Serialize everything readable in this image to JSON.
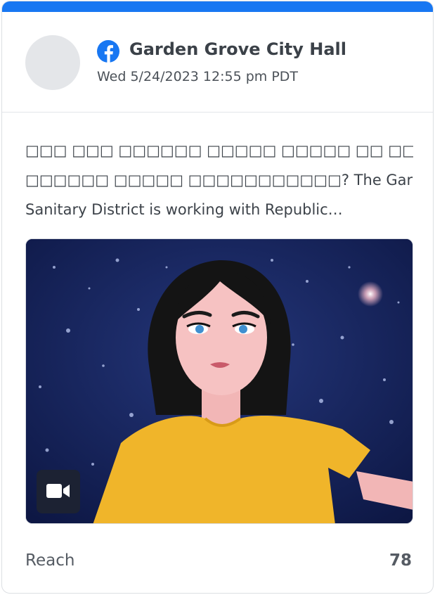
{
  "post": {
    "page_name": "Garden Grove City Hall",
    "timestamp": "Wed 5/24/2023 12:55 pm PDT",
    "text_line1": "□□□ □□□ □□□□□□ □□□□□ □□□□□ □□ □□□□□ □□□□□□□□",
    "text_line2": "□□□□□□ □□□□□ □□□□□□□□□□□? The Garden Grove",
    "text_line3": "Sanitary District is working with Republic…",
    "media_icon": "video-camera-icon",
    "platform_icon": "facebook-icon"
  },
  "metrics": {
    "reach_label": "Reach",
    "reach_value": "78"
  },
  "colors": {
    "accent": "#1877f2",
    "text": "#3d434a",
    "muted": "#555b63"
  }
}
